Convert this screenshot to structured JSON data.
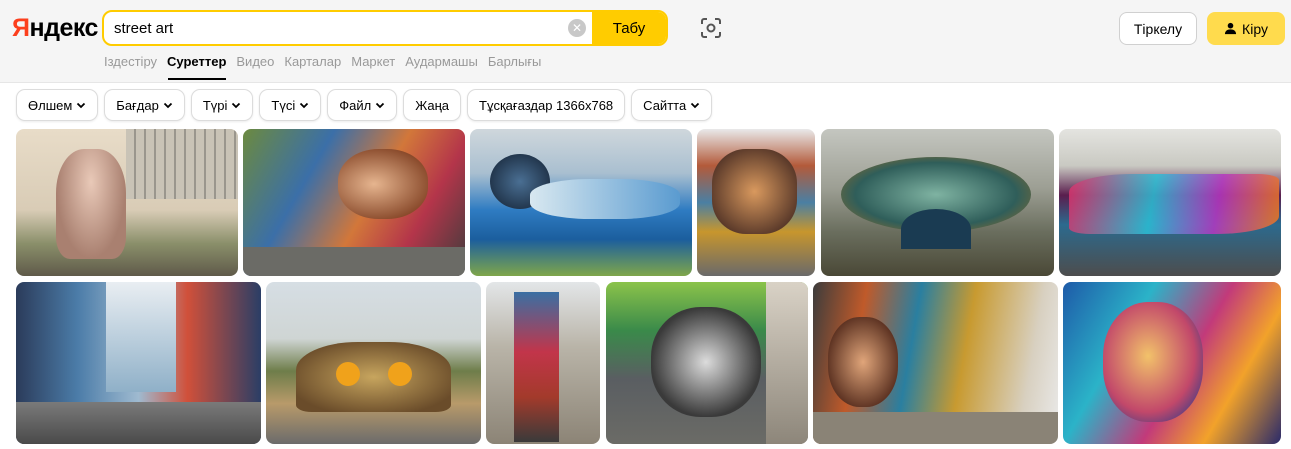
{
  "logo": {
    "first_letter": "Я",
    "rest": "ндекс"
  },
  "search": {
    "value": "street art",
    "button_label": "Табу",
    "clear_glyph": "✕"
  },
  "header": {
    "register_label": "Тіркелу",
    "login_label": "Кіру"
  },
  "tabs": [
    {
      "label": "Іздестіру",
      "active": false
    },
    {
      "label": "Суреттер",
      "active": true
    },
    {
      "label": "Видео",
      "active": false
    },
    {
      "label": "Карталар",
      "active": false
    },
    {
      "label": "Маркет",
      "active": false
    },
    {
      "label": "Аудармашы",
      "active": false
    },
    {
      "label": "Барлығы",
      "active": false
    }
  ],
  "filters": [
    {
      "label": "Өлшем",
      "dropdown": true
    },
    {
      "label": "Бағдар",
      "dropdown": true
    },
    {
      "label": "Түрі",
      "dropdown": true
    },
    {
      "label": "Түсі",
      "dropdown": true
    },
    {
      "label": "Файл",
      "dropdown": true
    },
    {
      "label": "Жаңа",
      "dropdown": false
    },
    {
      "label": "Тұсқағаздар 1366x768",
      "dropdown": false
    },
    {
      "label": "Сайтта",
      "dropdown": true
    }
  ],
  "colors": {
    "accent": "#ffcc00",
    "login_bg": "#ffdb4d",
    "logo_red": "#fc3f1d",
    "header_bg": "#f5f5f5"
  },
  "icons": {
    "lens": "camera-lens-icon",
    "user": "user-icon",
    "chevron": "chevron-down-icon"
  }
}
